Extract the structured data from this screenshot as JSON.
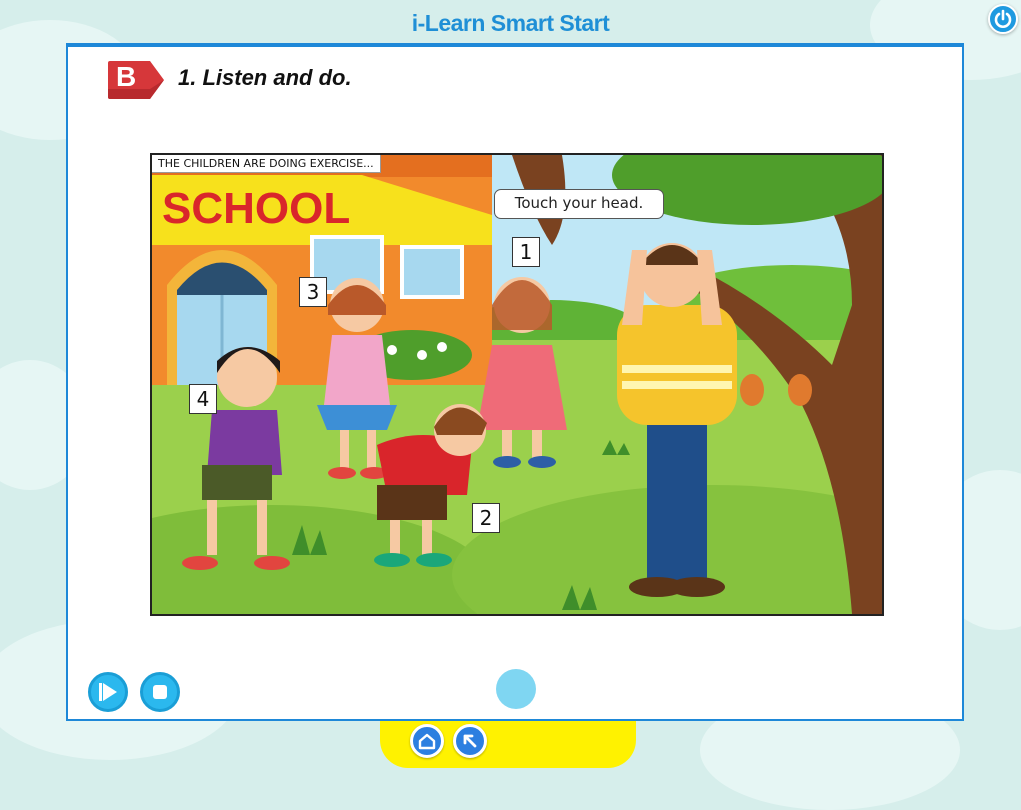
{
  "app": {
    "title": "i-Learn Smart Start"
  },
  "section": {
    "letter": "B",
    "title": "1. Listen and do."
  },
  "scene": {
    "caption": "THE CHILDREN ARE DOING EXERCISE...",
    "speech_bubble": "Touch your head.",
    "school_sign": "SCHOOL",
    "markers": [
      "1",
      "2",
      "3",
      "4"
    ]
  },
  "controls": {
    "play": "play-icon",
    "stop": "stop-icon",
    "record": "record-button"
  },
  "nav": {
    "home": "home-icon",
    "back": "back-arrow-icon"
  },
  "colors": {
    "accent": "#1e88d8",
    "badge": "#d6373a",
    "bottom_bar": "#fff200",
    "control": "#2bb8ee"
  }
}
